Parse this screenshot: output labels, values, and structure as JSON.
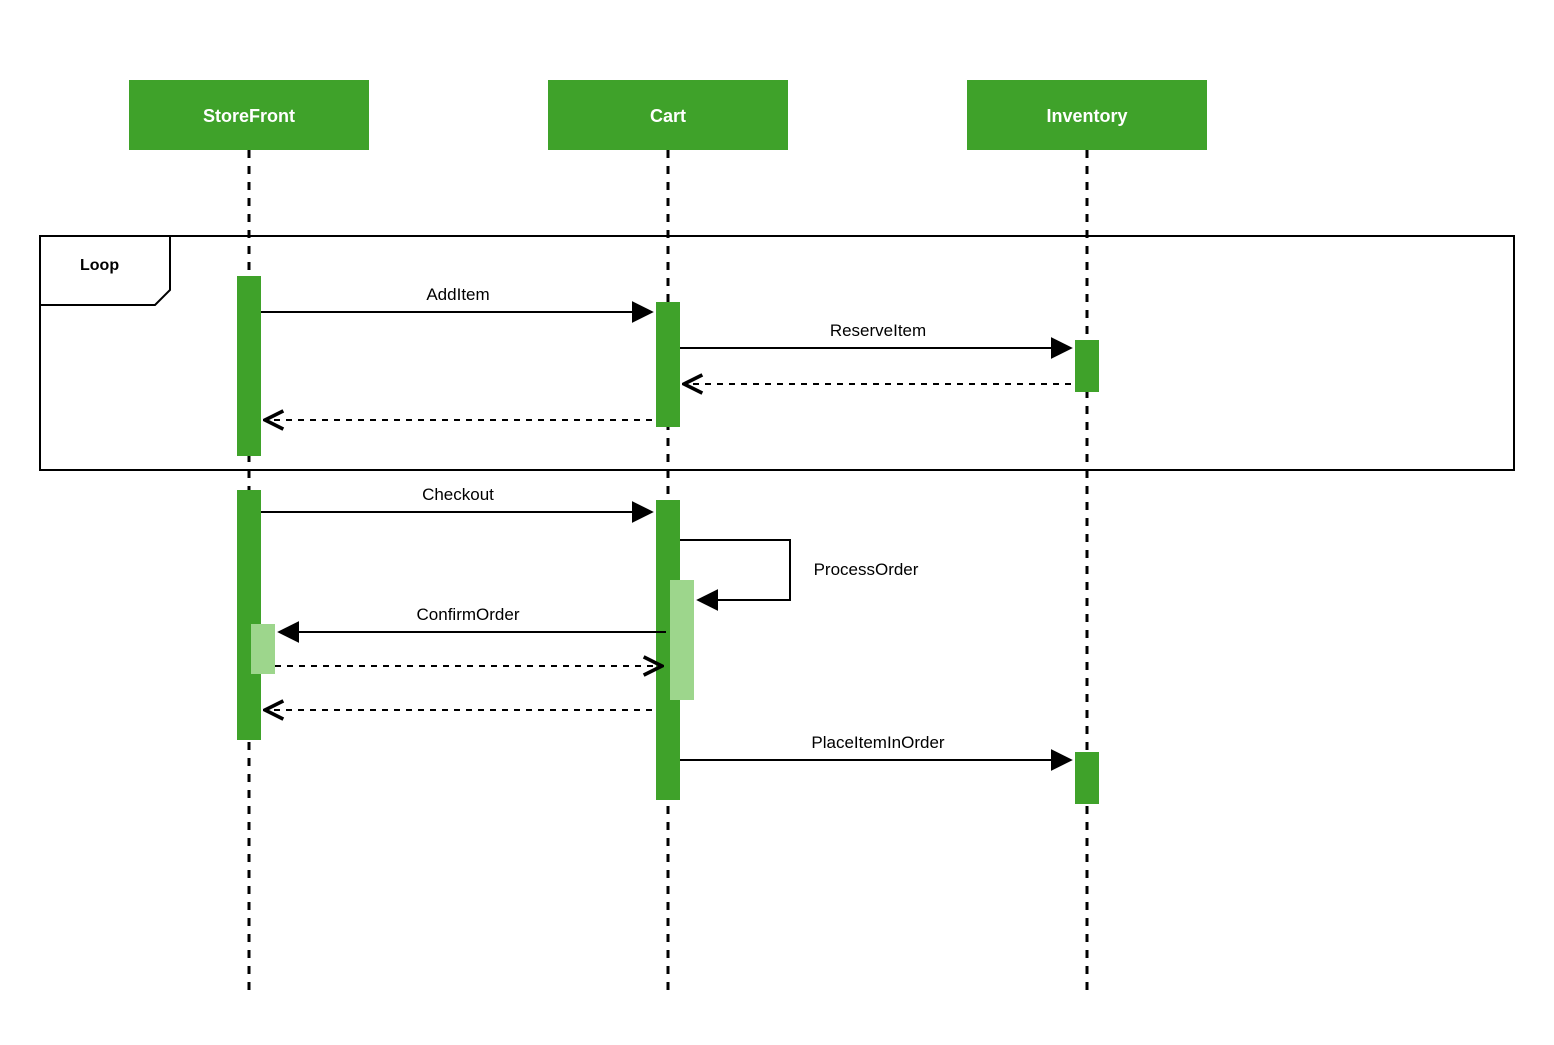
{
  "participants": {
    "storefront": "StoreFront",
    "cart": "Cart",
    "inventory": "Inventory"
  },
  "fragment": {
    "loop_label": "Loop"
  },
  "messages": {
    "add_item": "AddItem",
    "reserve_item": "ReserveItem",
    "checkout": "Checkout",
    "process_order": "ProcessOrder",
    "confirm_order": "ConfirmOrder",
    "place_item_in_order": "PlaceItemInOrder"
  }
}
